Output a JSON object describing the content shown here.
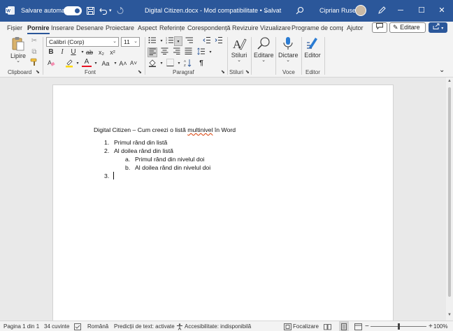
{
  "titlebar": {
    "autosave_label": "Salvare automată",
    "autosave_state": "on",
    "undo_icon": "undo-icon",
    "redo_icon": "redo-icon",
    "document_title": "Digital Citizen.docx  -  Mod compatibilitate • Salvat",
    "title_chevron": "⌄",
    "user_name": "Ciprian Rusen",
    "window_controls": {
      "minimize": "─",
      "maximize": "☐",
      "close": "✕"
    }
  },
  "tabs": {
    "items": [
      "Fișier",
      "Pornire",
      "Inserare",
      "Desenare",
      "Proiectare",
      "Aspect",
      "Referințe",
      "Corespondență",
      "Revizuire",
      "Vizualizare",
      "Programe de compl",
      "Ajutor"
    ],
    "active_index": 1,
    "editing_mode": "Editare",
    "comment_icon": "comment-icon",
    "share_icon": "share-icon"
  },
  "ribbon": {
    "clipboard": {
      "paste_label": "Lipire",
      "group_label": "Clipboard"
    },
    "font": {
      "font_name": "Calibri (Corp)",
      "font_size": "11",
      "bold": "B",
      "italic": "I",
      "underline": "U",
      "strike": "ab",
      "subscript": "x₂",
      "superscript": "x²",
      "font_color_glyph": "A",
      "change_case": "Aa",
      "grow": "A˄",
      "shrink": "A˅",
      "group_label": "Font"
    },
    "paragraph": {
      "group_label": "Paragraf",
      "pilcrow": "¶"
    },
    "styles": {
      "label": "Stiluri",
      "group_label": "Stiluri"
    },
    "editing": {
      "label": "Editare"
    },
    "voice": {
      "label": "Dictare",
      "group_label": "Voce"
    },
    "editor": {
      "label": "Editor",
      "group_label": "Editor"
    },
    "collapse_glyph": "⌄"
  },
  "document": {
    "heading_before": "Digital Citizen – Cum creezi o listă ",
    "heading_misspelled": "multinivel",
    "heading_after": " în Word",
    "list": [
      {
        "marker": "1.",
        "text": "Primul rând din listă"
      },
      {
        "marker": "2.",
        "text": "Al doilea rând din listă"
      },
      {
        "marker": "a.",
        "text": "Primul rând din nivelul doi"
      },
      {
        "marker": "b.",
        "text": "Al doilea rând din nivelul doi"
      },
      {
        "marker": "3.",
        "text": ""
      }
    ]
  },
  "statusbar": {
    "page": "Pagina 1 din 1",
    "words": "34 cuvinte",
    "language": "Română",
    "predictions": "Predicții de text: activate",
    "accessibility": "Accesibilitate: indisponibilă",
    "focus": "Focalizare",
    "zoom_minus": "−",
    "zoom_plus": "+",
    "zoom": "100%",
    "zoom_level_percent": 100
  },
  "colors": {
    "titlebar_bg": "#2b579a",
    "ribbon_bg": "#f3f3f3",
    "canvas_bg": "#e9e9e9",
    "page_bg": "#ffffff",
    "squiggle": "#d83b01",
    "font_color_red": "#e81123",
    "highlight_yellow": "#ffd800"
  }
}
